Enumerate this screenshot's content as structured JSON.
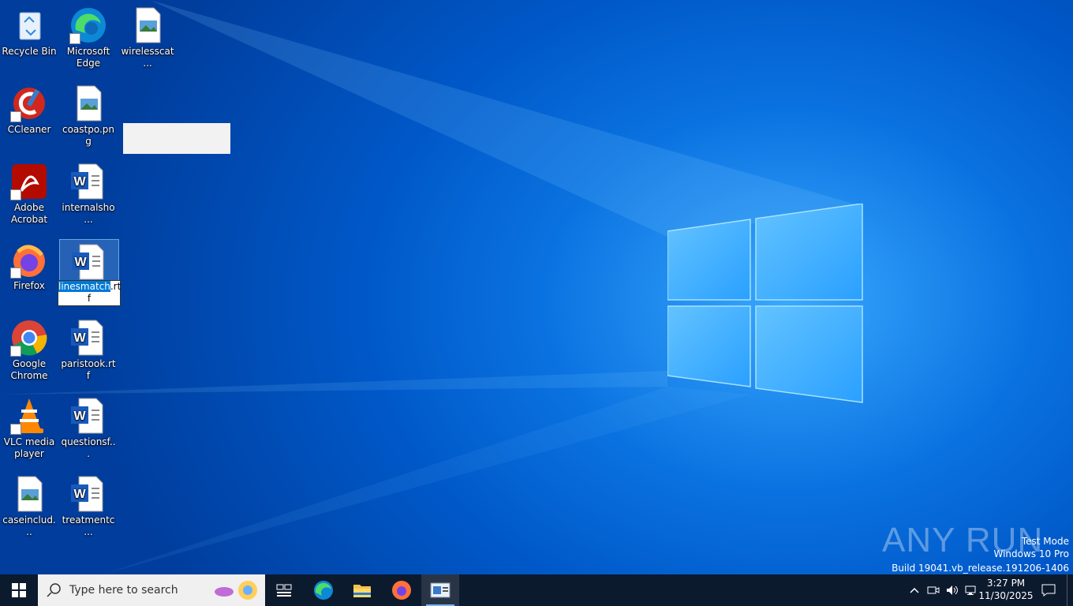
{
  "desktop": {
    "icons": [
      {
        "label": "Recycle Bin"
      },
      {
        "label": "Microsoft Edge"
      },
      {
        "label": "wirelesscat..."
      },
      {
        "label": "CCleaner"
      },
      {
        "label": "coastpo.png"
      },
      {
        "label": "Adobe Acrobat"
      },
      {
        "label": "internalsho..."
      },
      {
        "label": "Firefox"
      },
      {
        "label": "Google Chrome"
      },
      {
        "label": "paristook.rtf"
      },
      {
        "label": "VLC media player"
      },
      {
        "label": "questionsf..."
      },
      {
        "label": "caseinclud..."
      },
      {
        "label": "treatmentc..."
      }
    ],
    "rename": {
      "selected": "linesmatch",
      "rest_line1": ".rt",
      "rest_line2": "f"
    }
  },
  "watermark": {
    "line1": "Test Mode",
    "line2": "Windows 10 Pro",
    "line3": "Build 19041.vb_release.191206-1406",
    "brand": "ANY RUN"
  },
  "taskbar": {
    "search_placeholder": "Type here to search",
    "clock_time": "3:27 PM",
    "clock_date": "11/30/2025",
    "apps": [
      "task-view",
      "microsoft-edge",
      "file-explorer",
      "firefox",
      "image-viewer"
    ]
  }
}
